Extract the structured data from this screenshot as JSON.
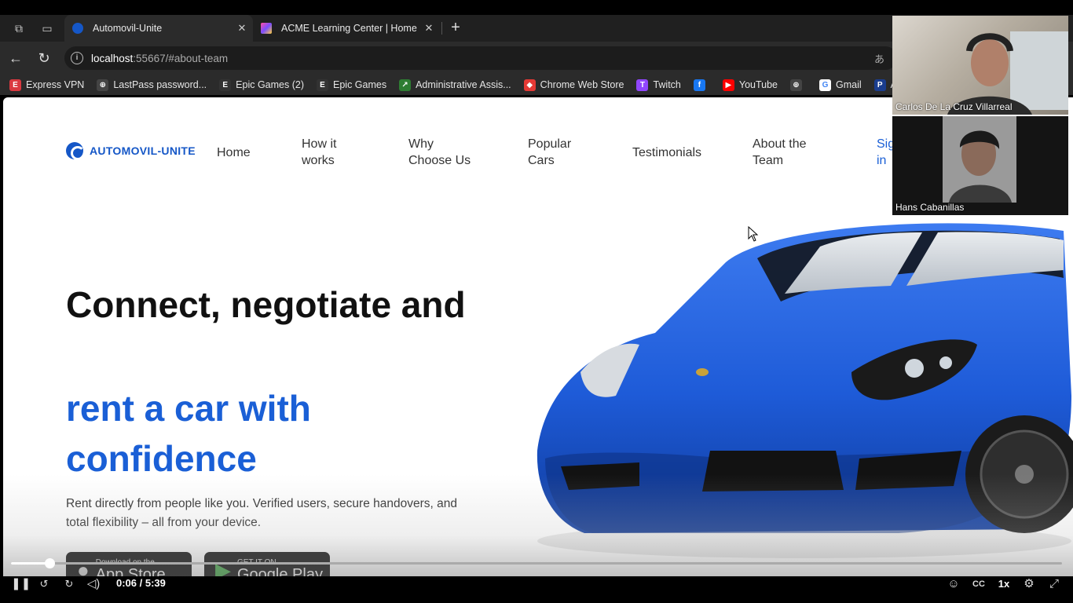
{
  "browser": {
    "tabs": [
      {
        "title": "Automovil-Unite",
        "active": true
      },
      {
        "title": "ACME Learning Center | Home",
        "active": false
      }
    ],
    "address": {
      "host": "localhost",
      "rest": ":55667/#about-team"
    },
    "bookmarks": [
      {
        "label": "Express VPN",
        "icon": "expressvpn-icon",
        "color": "#da3940"
      },
      {
        "label": "LastPass password...",
        "icon": "globe-icon",
        "color": "#444"
      },
      {
        "label": "Epic Games (2)",
        "icon": "epic-icon",
        "color": "#333"
      },
      {
        "label": "Epic Games",
        "icon": "epic-icon",
        "color": "#333"
      },
      {
        "label": "Administrative Assis...",
        "icon": "chart-icon",
        "color": "#2e7d32"
      },
      {
        "label": "Chrome Web Store",
        "icon": "webstore-icon",
        "color": "#e53935"
      },
      {
        "label": "Twitch",
        "icon": "twitch-icon",
        "color": "#9146ff"
      },
      {
        "label": "",
        "icon": "facebook-icon",
        "color": "#1877f2"
      },
      {
        "label": "YouTube",
        "icon": "youtube-icon",
        "color": "#ff0000"
      },
      {
        "label": "",
        "icon": "globe-icon",
        "color": "#444"
      },
      {
        "label": "Gmail",
        "icon": "google-icon",
        "color": "#fff"
      },
      {
        "label": "Acceso a",
        "icon": "paypal-icon",
        "color": "#1a3d8f"
      }
    ]
  },
  "site": {
    "logo": "AUTOMOVIL-UNITE",
    "nav": [
      "Home",
      "How it works",
      "Why Choose Us",
      "Popular Cars",
      "Testimonials",
      "About the Team",
      "Sign in"
    ],
    "hero": {
      "line1": "Connect, negotiate and",
      "line2": "rent a car with confidence",
      "description": "Rent directly from people like you. Verified users, secure handovers, and total flexibility – all from your device."
    },
    "stores": [
      {
        "small": "Download on the",
        "big": "App Store"
      },
      {
        "small": "GET IT ON",
        "big": "Google Play"
      }
    ],
    "accent": "#1a5fd6",
    "car_color": "#1e5bd8"
  },
  "call": {
    "participants": [
      "Carlos De La Cruz Villarreal",
      "Hans Cabanillas"
    ]
  },
  "player": {
    "time": "0:06 / 5:39",
    "progress": 0.019,
    "speed": "1x"
  }
}
